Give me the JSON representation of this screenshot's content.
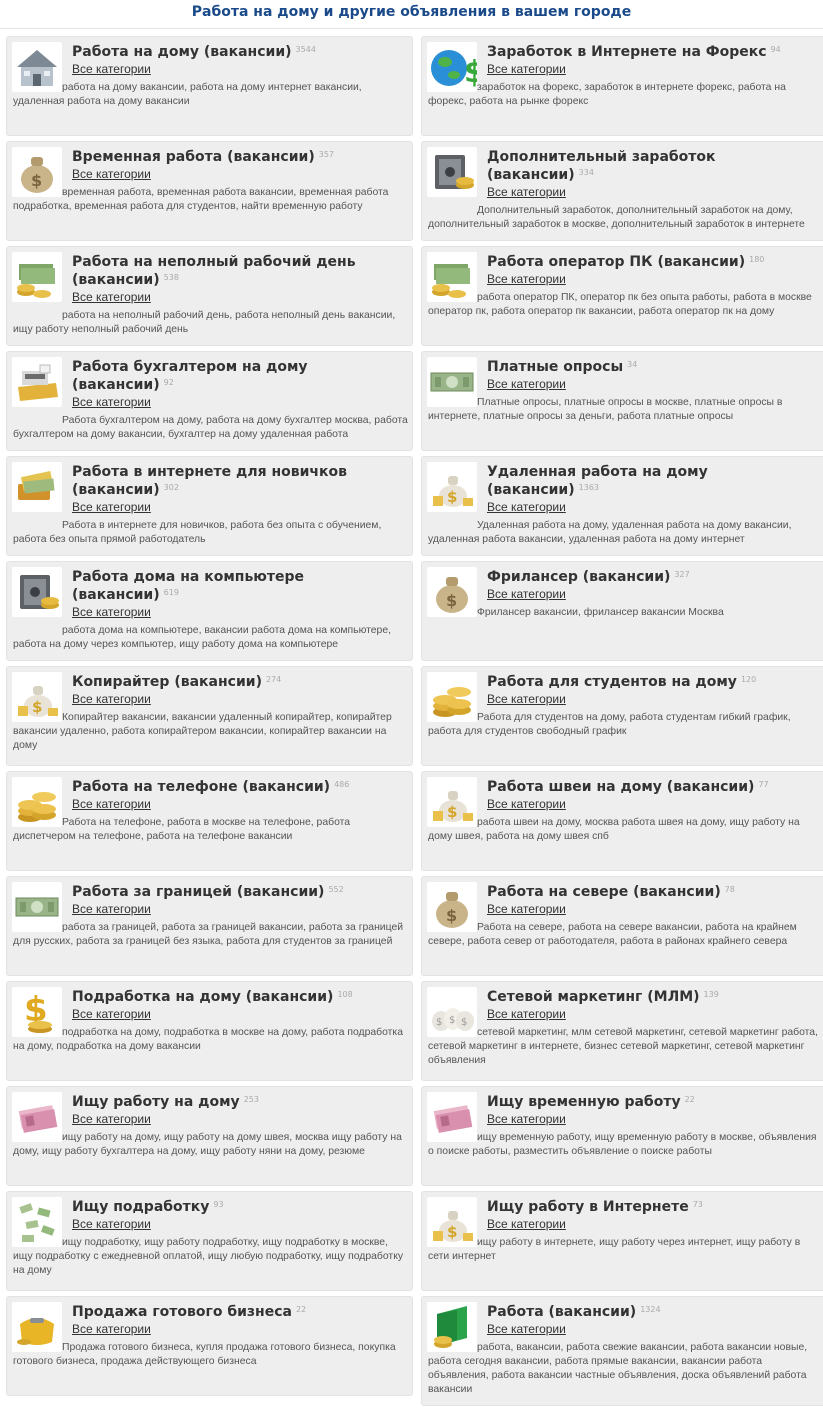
{
  "page": {
    "heading": "Работа на дому и другие объявления в вашем городе",
    "all_categories_label": "Все категории"
  },
  "cards": [
    {
      "title": "Работа на дому (вакансии)",
      "count": "3544",
      "desc": "работа на дому вакансии, работа на дому интернет вакансии, удаленная работа на дому вакансии",
      "icon": "house-icon"
    },
    {
      "title": "Заработок в Интернете на Форекс",
      "count": "94",
      "desc": "заработок на форекс, заработок в интернете форекс, работа на форекс, работа на рынке форекс",
      "icon": "globe-dollar-icon"
    },
    {
      "title": "Временная работа (вакансии)",
      "count": "357",
      "desc": "временная работа, временная работа вакансии, временная работа подработка, временная работа для студентов, найти временную работу",
      "icon": "money-bag-icon"
    },
    {
      "title": "Дополнительный заработок (вакансии)",
      "count": "334",
      "desc": "Дополнительный заработок, дополнительный заработок на дому, дополнительный заработок в москве, дополнительный заработок в интернете",
      "icon": "safe-icon"
    },
    {
      "title": "Работа на неполный рабочий день (вакансии)",
      "count": "538",
      "desc": "работа на неполный рабочий день, работа неполный день вакансии, ищу работу неполный рабочий день",
      "icon": "cash-coins-icon"
    },
    {
      "title": "Работа оператор ПК (вакансии)",
      "count": "180",
      "desc": "работа оператор ПК, оператор пк без опыта работы, работа в москве оператор пк, работа оператор пк вакансии, работа оператор пк на дому",
      "icon": "cash-coins-icon"
    },
    {
      "title": "Работа бухгалтером на дому (вакансии)",
      "count": "92",
      "desc": "Работа бухгалтером на дому, работа на дому бухгалтер москва, работа бухгалтером на дому вакансии, бухгалтер на дому удаленная работа",
      "icon": "cash-register-icon"
    },
    {
      "title": "Платные опросы",
      "count": "34",
      "desc": "Платные опросы, платные опросы в москве, платные опросы в интернете, платные опросы за деньги, работа платные опросы",
      "icon": "banknote-icon"
    },
    {
      "title": "Работа в интернете для новичков (вакансии)",
      "count": "302",
      "desc": "Работа в интернете для новичков, работа без опыта с обучением, работа без опыта прямой работодатель",
      "icon": "wallet-icon"
    },
    {
      "title": "Удаленная работа на дому (вакансии)",
      "count": "1363",
      "desc": "Удаленная работа на дому, удаленная работа на дому вакансии, удаленная работа вакансии, удаленная работа на дому интернет",
      "icon": "gold-bag-icon"
    },
    {
      "title": "Работа дома на компьютере (вакансии)",
      "count": "619",
      "desc": "работа дома на компьютере, вакансии работа дома на компьютере, работа на дому через компьютер, ищу работу дома на компьютере",
      "icon": "safe-icon"
    },
    {
      "title": "Фрилансер (вакансии)",
      "count": "327",
      "desc": "Фрилансер вакансии, фрилансер вакансии Москва",
      "icon": "money-bag-icon"
    },
    {
      "title": "Копирайтер (вакансии)",
      "count": "274",
      "desc": "Копирайтер вакансии, вакансии удаленный копирайтер, копирайтер вакансии удаленно, работа копирайтером вакансии, копирайтер вакансии на дому",
      "icon": "gold-bag-icon"
    },
    {
      "title": "Работа для студентов на дому",
      "count": "120",
      "desc": "Работа для студентов на дому, работа студентам гибкий график, работа для студентов свободный график",
      "icon": "coins-stack-icon"
    },
    {
      "title": "Работа на телефоне (вакансии)",
      "count": "486",
      "desc": "Работа на телефоне, работа в москве на телефоне, работа диспетчером на телефоне, работа на телефоне вакансии",
      "icon": "coins-stack-icon"
    },
    {
      "title": "Работа швеи на дому (вакансии)",
      "count": "77",
      "desc": "работа швеи на дому, москва работа швея на дому, ищу работу на дому швея, работа на дому швея спб",
      "icon": "gold-bag-icon"
    },
    {
      "title": "Работа за границей (вакансии)",
      "count": "552",
      "desc": "работа за границей, работа за границей вакансии, работа за границей для русских, работа за границей без языка, работа для студентов за границей",
      "icon": "banknote-icon"
    },
    {
      "title": "Работа на севере (вакансии)",
      "count": "78",
      "desc": "Работа на севере, работа на севере вакансии, работа на крайнем севере, работа север от работодателя, работа в районах крайнего севера",
      "icon": "money-bag-icon"
    },
    {
      "title": "Подработка на дому (вакансии)",
      "count": "108",
      "desc": "подработка на дому, подработка в москве на дому, работа подработка на дому, подработка на дому вакансии",
      "icon": "dollar-sign-icon"
    },
    {
      "title": "Сетевой маркетинг (МЛМ)",
      "count": "139",
      "desc": "сетевой маркетинг, млм сетевой маркетинг, сетевой маркетинг работа, сетевой маркетинг в интернете, бизнес сетевой маркетинг, сетевой маркетинг объявления",
      "icon": "money-bags-icon"
    },
    {
      "title": "Ищу работу на дому",
      "count": "253",
      "desc": "ищу работу на дому, ищу работу на дому швея, москва ищу работу на дому, ищу работу бухгалтера на дому, ищу работу няни на дому, резюме",
      "icon": "banknote-stack-icon"
    },
    {
      "title": "Ищу временную работу",
      "count": "22",
      "desc": "ищу временную работу, ищу временную работу в москве, объявления о поиске работы, разместить объявление о поиске работы",
      "icon": "banknote-stack-icon"
    },
    {
      "title": "Ищу подработку",
      "count": "93",
      "desc": "ищу подработку, ищу работу подработку, ищу подработку в москве, ищу подработку с ежедневной оплатой, ищу любую подработку, ищу подработку на дому",
      "icon": "flying-money-icon"
    },
    {
      "title": "Ищу работу в Интернете",
      "count": "73",
      "desc": "ищу работу в интернете, ищу работу через интернет, ищу работу в сети интернет",
      "icon": "gold-bag-icon"
    },
    {
      "title": "Продажа готового бизнеса",
      "count": "22",
      "desc": "Продажа готового бизнеса, купля продажа готового бизнеса, покупка готового бизнеса, продажа действующего бизнеса",
      "icon": "purse-icon"
    },
    {
      "title": "Работа (вакансии)",
      "count": "1324",
      "desc": "работа, вакансии, работа свежие вакансии, работа вакансии новые, работа сегодня вакансии, работа прямые вакансии, вакансии работа объявления, работа вакансии частные объявления, доска объявлений работа вакансии",
      "icon": "green-folder-icon"
    }
  ]
}
